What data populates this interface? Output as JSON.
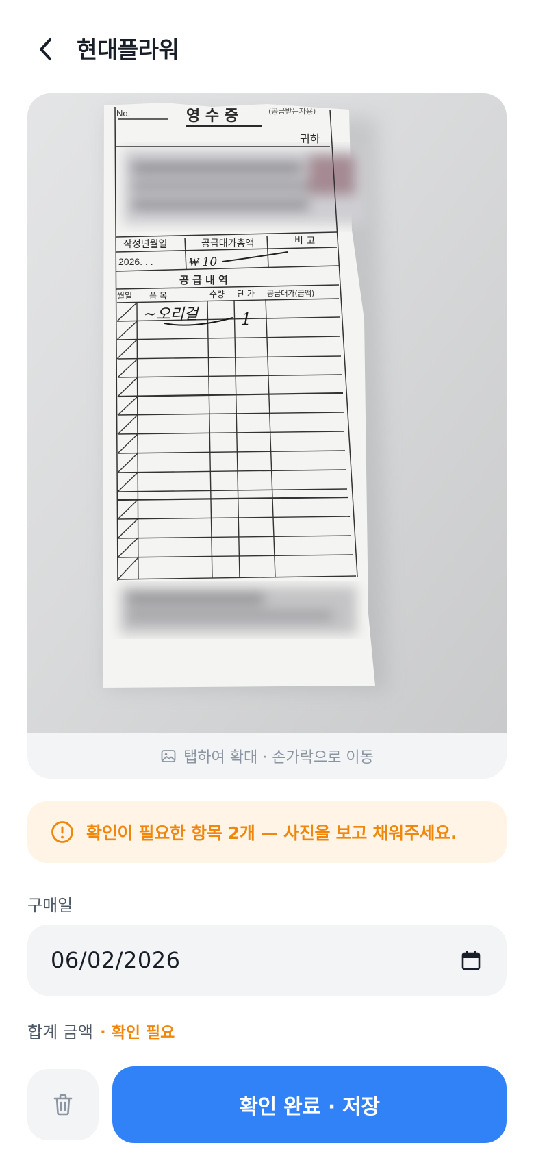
{
  "header": {
    "title": "현대플라워",
    "back_icon": "chevron-left-icon"
  },
  "receipt_photo": {
    "caption": "탭하여 확대 · 손가락으로 이동",
    "caption_icon": "image-icon",
    "document": {
      "no_label": "No.",
      "title": "영 수 증",
      "title_note": "(공급받는자용)",
      "honorific": "귀하",
      "col_date": "작성년월일",
      "col_total": "공급대가총액",
      "col_remark": "비 고",
      "date_value": "2026. . .",
      "amount_value": "₩ 10",
      "section_title": "공 급 내 역",
      "item_cols": [
        "월일",
        "품 목",
        "수량",
        "단 가",
        "공급대가(금액)"
      ],
      "item_handwritten": "~오리걸",
      "qty_handwritten": "1"
    }
  },
  "warning": {
    "icon": "alert-circle-icon",
    "text": "확인이 필요한 항목 2개 — 사진을 보고 채워주세요.",
    "color": "#f0870a",
    "background": "#fff4e6"
  },
  "form": {
    "purchase_date": {
      "label": "구매일",
      "value": "06/02/2026",
      "icon": "calendar-icon"
    },
    "total_amount": {
      "label": "합계 금액",
      "status": "· 확인 필요"
    }
  },
  "actions": {
    "delete_icon": "trash-icon",
    "confirm_label": "확인 완료 · 저장",
    "primary_color": "#3182f6"
  }
}
